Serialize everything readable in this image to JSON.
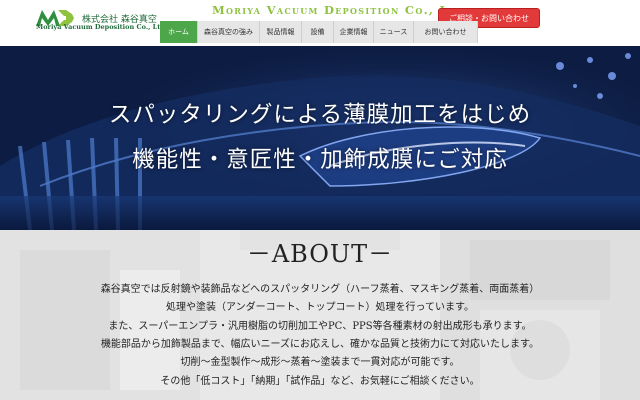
{
  "header": {
    "logo_letters": "MVD",
    "company_jp": "株式会社 森谷真空",
    "company_en": "Moriya Vacuum Deposition Co., Ltd.",
    "brand_title": "Moriya Vacuum Deposition Co., Ltd.",
    "contact_label": "ご相談・お問い合わせ",
    "colors": {
      "brand_green": "#8ec23f",
      "nav_active": "#4ea64a",
      "contact_red": "#e23a3a"
    }
  },
  "nav": {
    "items": [
      {
        "label": "ホーム",
        "active": true
      },
      {
        "label": "森谷真空の強み",
        "active": false
      },
      {
        "label": "製品情報",
        "active": false
      },
      {
        "label": "設備",
        "active": false
      },
      {
        "label": "企業情報",
        "active": false
      },
      {
        "label": "ニュース",
        "active": false
      },
      {
        "label": "お問い合わせ",
        "active": false
      }
    ]
  },
  "hero": {
    "line1": "スパッタリングによる薄膜加工をはじめ",
    "line2": "機能性・意匠性・加飾成膜にご対応"
  },
  "about": {
    "title": "－ABOUT－",
    "lines": [
      "森谷真空では反射鏡や装飾品などへのスパッタリング（ハーフ蒸着、マスキング蒸着、両面蒸着）",
      "処理や塗装（アンダーコート、トップコート）処理を行っています。",
      "また、スーパーエンプラ・汎用樹脂の切削加工やPC、PPS等各種素材の射出成形も承ります。",
      "機能部品から加飾製品まで、幅広いニーズにお応えし、確かな品質と技術力にて対応いたします。",
      "切削～金型製作～成形～蒸着～塗装まで一貫対応が可能です。",
      "その他「低コスト」「納期」「試作品」など、お気軽にご相談ください。"
    ]
  }
}
